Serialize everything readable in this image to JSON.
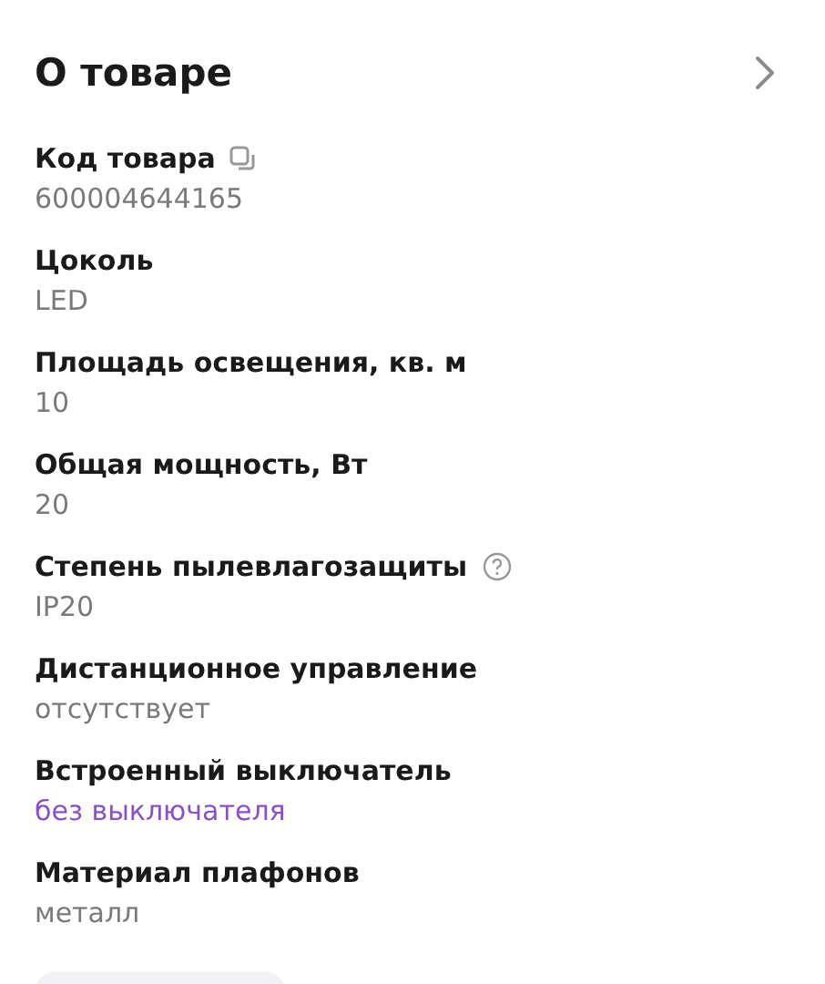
{
  "title": "О товаре",
  "properties": [
    {
      "label": "Код товара",
      "value": "600004644165",
      "kind": "copyable"
    },
    {
      "label": "Цоколь",
      "value": "LED",
      "kind": "plain"
    },
    {
      "label": "Площадь освещения, кв. м",
      "value": "10",
      "kind": "plain"
    },
    {
      "label": "Общая мощность, Вт",
      "value": "20",
      "kind": "plain"
    },
    {
      "label": "Степень пылевлагозащиты",
      "value": "IP20",
      "kind": "hint"
    },
    {
      "label": "Дистанционное управление",
      "value": "отсутствует",
      "kind": "plain"
    },
    {
      "label": "Встроенный выключатель",
      "value": "без выключателя",
      "kind": "link"
    },
    {
      "label": "Материал плафонов",
      "value": "металл",
      "kind": "plain"
    }
  ]
}
